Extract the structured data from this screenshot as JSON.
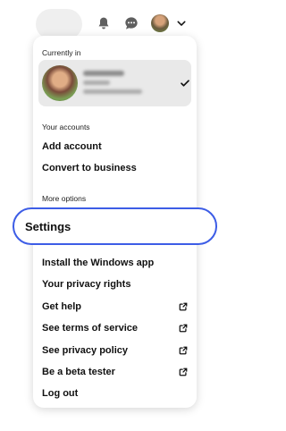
{
  "header": {
    "icons": [
      "bell-icon",
      "chat-icon",
      "avatar",
      "chevron-down-icon"
    ]
  },
  "menu": {
    "current_label": "Currently in",
    "accounts_label": "Your accounts",
    "add_account": "Add account",
    "convert_business": "Convert to business",
    "more_options_label": "More options",
    "settings": "Settings",
    "install_app": "Install the Windows app",
    "privacy_rights": "Your privacy rights",
    "get_help": "Get help",
    "terms": "See terms of service",
    "privacy_policy": "See privacy policy",
    "beta": "Be a beta tester",
    "logout": "Log out"
  },
  "colors": {
    "highlight": "#3d5de6",
    "card_background": "#e9e9e9"
  }
}
